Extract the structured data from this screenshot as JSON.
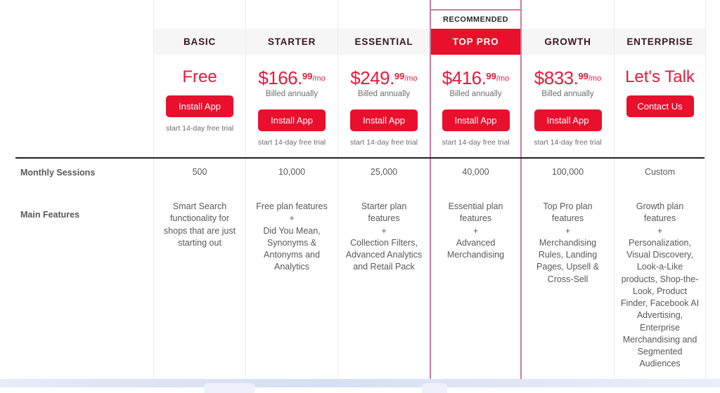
{
  "table": {
    "recommended_badge": "RECOMMENDED",
    "row_labels": {
      "sessions": "Monthly Sessions",
      "features": "Main Features"
    },
    "colors": {
      "accent_red": "#e8102d",
      "price_red": "#e8193d",
      "featured_border": "#cc7ca2",
      "header_bg": "#f6f6f6",
      "header_text": "#3d1520",
      "body_text": "#58595b"
    },
    "plans": [
      {
        "name": "BASIC",
        "price_word": "Free",
        "price_main": "",
        "price_cents": "",
        "price_per": "",
        "billed": "",
        "cta": "Install App",
        "trial": "start 14-day free trial",
        "sessions": "500",
        "features": "Smart Search\nfunctionality for\nshops that are just\nstarting out",
        "featured": false
      },
      {
        "name": "STARTER",
        "price_word": "",
        "price_main": "$166.",
        "price_cents": "99",
        "price_per": "/mo",
        "billed": "Billed annually",
        "cta": "Install App",
        "trial": "start 14-day free trial",
        "sessions": "10,000",
        "features": "Free plan features\n+\nDid You Mean,\nSynonyms &\nAntonyms and\nAnalytics",
        "featured": false
      },
      {
        "name": "ESSENTIAL",
        "price_word": "",
        "price_main": "$249.",
        "price_cents": "99",
        "price_per": "/mo",
        "billed": "Billed annually",
        "cta": "Install App",
        "trial": "start 14-day free trial",
        "sessions": "25,000",
        "features": "Starter plan\nfeatures\n+\nCollection Filters,\nAdvanced Analytics\nand Retail Pack",
        "featured": false
      },
      {
        "name": "TOP PRO",
        "price_word": "",
        "price_main": "$416.",
        "price_cents": "99",
        "price_per": "/mo",
        "billed": "Billed annually",
        "cta": "Install App",
        "trial": "start 14-day free trial",
        "sessions": "40,000",
        "features": "Essential plan\nfeatures\n+\nAdvanced\nMerchandising",
        "featured": true
      },
      {
        "name": "GROWTH",
        "price_word": "",
        "price_main": "$833.",
        "price_cents": "99",
        "price_per": "/mo",
        "billed": "Billed annually",
        "cta": "Install App",
        "trial": "start 14-day free trial",
        "sessions": "100,000",
        "features": "Top Pro plan\nfeatures\n+\nMerchandising\nRules, Landing\nPages, Upsell &\nCross-Sell",
        "featured": false
      },
      {
        "name": "ENTERPRISE",
        "price_word": "Let's Talk",
        "price_main": "",
        "price_cents": "",
        "price_per": "",
        "billed": "",
        "cta": "Contact Us",
        "trial": "",
        "sessions": "Custom",
        "features": "Growth plan\nfeatures\n+\nPersonalization,\nVisual Discovery,\nLook-a-Like\nproducts, Shop-the-\nLook, Product\nFinder, Facebook AI\nAdvertising,\nEnterprise\nMerchandising and\nSegmented\nAudiences",
        "featured": false
      }
    ]
  }
}
